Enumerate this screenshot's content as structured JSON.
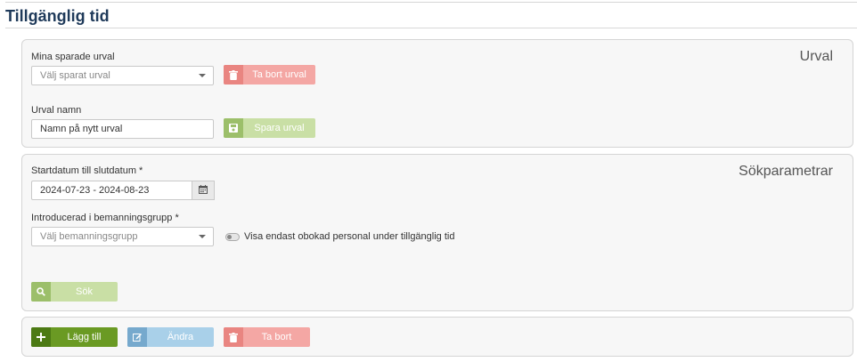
{
  "page": {
    "title": "Tillgänglig tid"
  },
  "urval": {
    "heading": "Urval",
    "saved_label": "Mina sparade urval",
    "saved_select": {
      "value": "Välj sparat urval"
    },
    "delete_button": "Ta bort urval",
    "name_label": "Urval namn",
    "name_input": {
      "placeholder": "Namn på nytt urval"
    },
    "save_button": "Spara urval"
  },
  "search": {
    "heading": "Sökparametrar",
    "date_label": "Startdatum till slutdatum *",
    "date_value": "2024-07-23 - 2024-08-23",
    "group_label": "Introducerad i bemanningsgrupp *",
    "group_select": {
      "value": "Välj bemanningsgrupp"
    },
    "toggle_label": "Visa endast obokad personal under tillgänglig tid",
    "search_button": "Sök"
  },
  "actions": {
    "add_button": "Lägg till",
    "edit_button": "Ändra",
    "delete_button": "Ta bort"
  },
  "colors": {
    "title": "#1f3a5a",
    "danger": "#f4a7a4",
    "success_light": "#c9dfa5",
    "success": "#6a9a23",
    "info": "#a9d0e9"
  }
}
